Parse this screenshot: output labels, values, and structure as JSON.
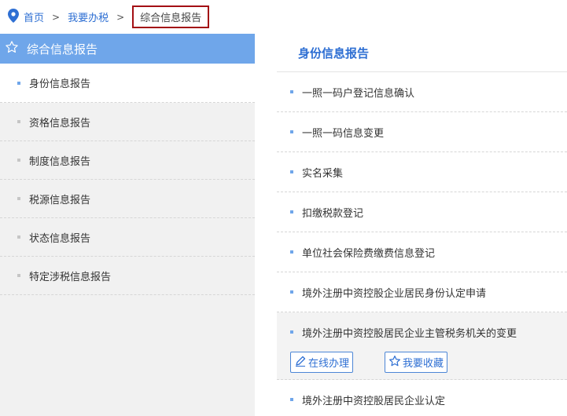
{
  "breadcrumb": {
    "home": "首页",
    "sep1": ">",
    "level2": "我要办税",
    "sep2": ">",
    "current": "综合信息报告"
  },
  "sidebar": {
    "title": "综合信息报告",
    "items": [
      {
        "label": "身份信息报告",
        "active": true
      },
      {
        "label": "资格信息报告"
      },
      {
        "label": "制度信息报告"
      },
      {
        "label": "税源信息报告"
      },
      {
        "label": "状态信息报告"
      },
      {
        "label": "特定涉税信息报告"
      }
    ]
  },
  "main": {
    "tab": "身份信息报告",
    "items": [
      {
        "label": "一照一码户登记信息确认"
      },
      {
        "label": "一照一码信息变更"
      },
      {
        "label": "实名采集"
      },
      {
        "label": "扣缴税款登记"
      },
      {
        "label": "单位社会保险费缴费信息登记"
      },
      {
        "label": "境外注册中资控股企业居民身份认定申请"
      },
      {
        "label": "境外注册中资控股居民企业主管税务机关的变更",
        "expanded": true
      },
      {
        "label": "境外注册中资控股居民企业认定"
      }
    ],
    "actions": {
      "online": "在线办理",
      "favorite": "我要收藏"
    }
  },
  "colors": {
    "accent": "#6fa6ea",
    "link": "#2e6fd3",
    "highlight_border": "#a30f14"
  }
}
